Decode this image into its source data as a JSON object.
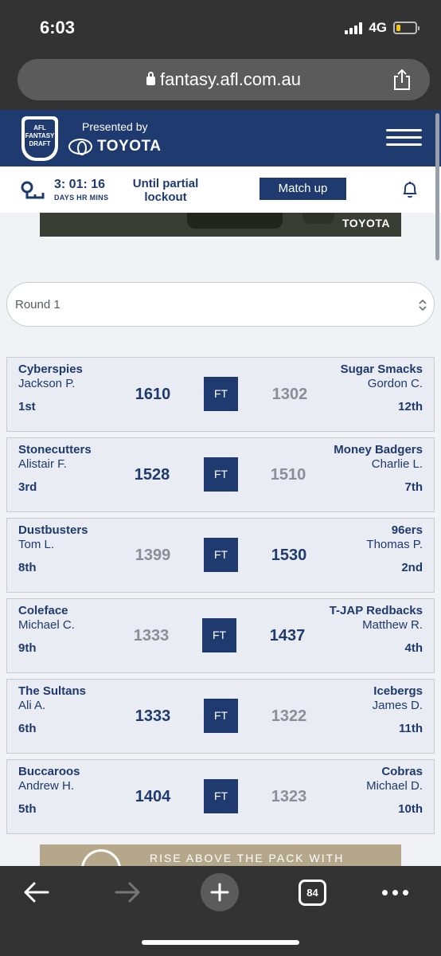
{
  "status_bar": {
    "time": "6:03",
    "network": "4G"
  },
  "browser": {
    "url": "fantasy.afl.com.au",
    "tab_count": "84"
  },
  "header": {
    "logo_text": "AFL FANTASY DRAFT",
    "presented_by": "Presented by",
    "sponsor": "TOYOTA"
  },
  "countdown": {
    "value": "3: 01: 16",
    "units": "DAYS HR MINS",
    "until_label": "Until partial lockout",
    "match_up_label": "Match up"
  },
  "ad_top": {
    "brand": "TOYOTA"
  },
  "round_select": {
    "selected": "Round 1"
  },
  "matches": [
    {
      "home": {
        "team": "Cyberspies",
        "coach": "Jackson P.",
        "rank": "1st",
        "score": "1610"
      },
      "status": "FT",
      "away": {
        "team": "Sugar Smacks",
        "coach": "Gordon C.",
        "rank": "12th",
        "score": "1302"
      }
    },
    {
      "home": {
        "team": "Stonecutters",
        "coach": "Alistair F.",
        "rank": "3rd",
        "score": "1528"
      },
      "status": "FT",
      "away": {
        "team": "Money Badgers",
        "coach": "Charlie L.",
        "rank": "7th",
        "score": "1510"
      }
    },
    {
      "home": {
        "team": "Dustbusters",
        "coach": "Tom L.",
        "rank": "8th",
        "score": "1399"
      },
      "status": "FT",
      "away": {
        "team": "96ers",
        "coach": "Thomas P.",
        "rank": "2nd",
        "score": "1530"
      }
    },
    {
      "home": {
        "team": "Coleface",
        "coach": "Michael C.",
        "rank": "9th",
        "score": "1333"
      },
      "status": "FT",
      "away": {
        "team": "T-JAP Redbacks",
        "coach": "Matthew R.",
        "rank": "4th",
        "score": "1437"
      }
    },
    {
      "home": {
        "team": "The Sultans",
        "coach": "Ali A.",
        "rank": "6th",
        "score": "1333"
      },
      "status": "FT",
      "away": {
        "team": "Icebergs",
        "coach": "James D.",
        "rank": "11th",
        "score": "1322"
      }
    },
    {
      "home": {
        "team": "Buccaroos",
        "coach": "Andrew H.",
        "rank": "5th",
        "score": "1404"
      },
      "status": "FT",
      "away": {
        "team": "Cobras",
        "coach": "Michael D.",
        "rank": "10th",
        "score": "1323"
      }
    }
  ],
  "ad_bottom": {
    "text": "RISE ABOVE THE PACK WITH"
  },
  "colors": {
    "navy": "#1e3a6e",
    "win_score": "#1e3a6e",
    "lose_score": "#8a8e96",
    "card_bg": "#e9ecf2"
  }
}
